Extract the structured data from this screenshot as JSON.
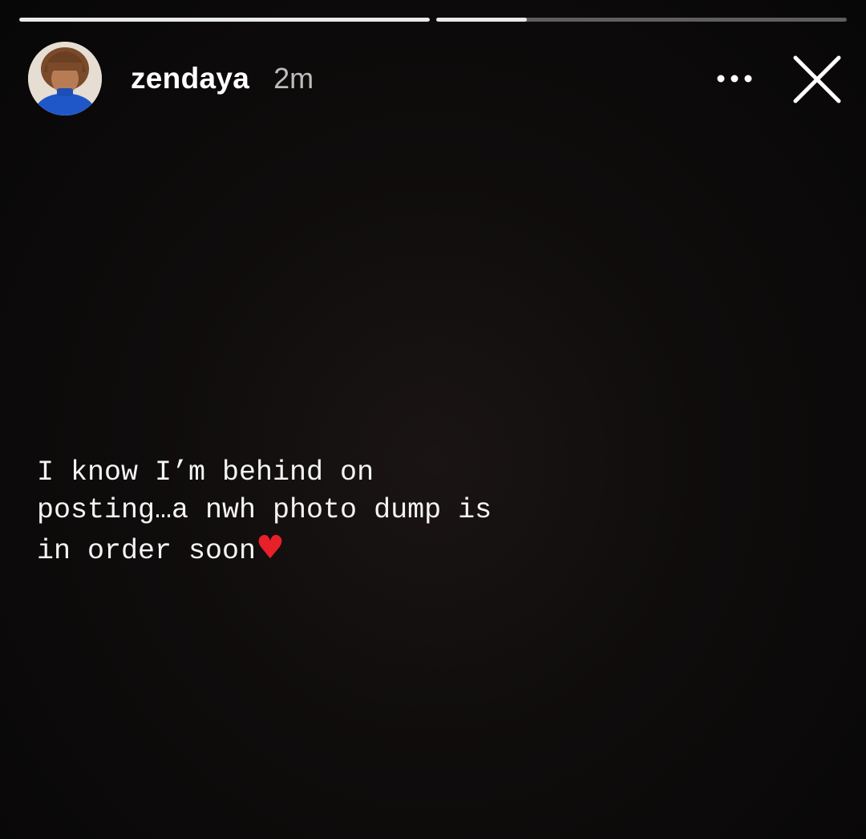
{
  "progress": {
    "segments": [
      {
        "fill": 1.0
      },
      {
        "fill": 0.22
      }
    ]
  },
  "header": {
    "username": "zendaya",
    "time": "2m",
    "more_icon": "more-horizontal-icon",
    "close_icon": "close-icon"
  },
  "story": {
    "caption_lines": [
      "I know I’m behind on",
      "posting…a nwh photo dump is",
      "in order soon"
    ],
    "caption_emoji": "♥"
  },
  "colors": {
    "heart": "#e8202a",
    "avatar_sweater": "#1f57c9"
  }
}
